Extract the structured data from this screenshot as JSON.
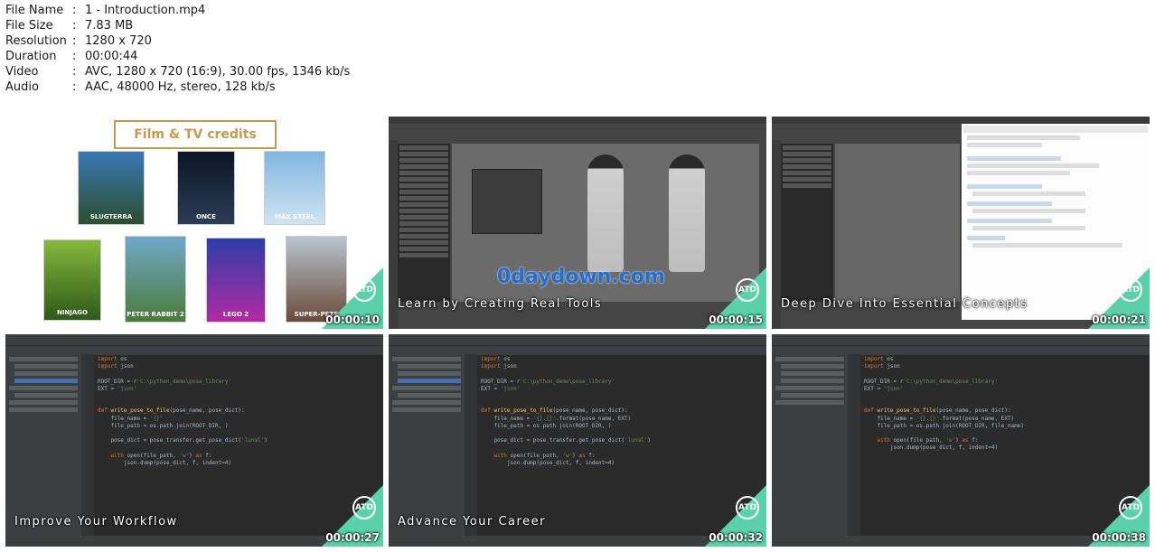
{
  "file_info": [
    {
      "label": "File Name",
      "value": "1 - Introduction.mp4"
    },
    {
      "label": "File Size",
      "value": "7.83 MB"
    },
    {
      "label": "Resolution",
      "value": "1280 x 720"
    },
    {
      "label": "Duration",
      "value": "00:00:44"
    },
    {
      "label": "Video",
      "value": "AVC, 1280 x 720 (16:9), 30.00 fps, 1346 kb/s"
    },
    {
      "label": "Audio",
      "value": "AAC, 48000 Hz, stereo, 128 kb/s"
    }
  ],
  "separator": ":",
  "badge": "ATD",
  "accent": "#5ad1a8",
  "thumbs": [
    {
      "caption": "",
      "timestamp": "00:00:10",
      "film_title": "Film & TV credits",
      "posters": [
        "SLUGTERRA",
        "ONCE",
        "MAX STEEL",
        "NINJAGO",
        "PETER RABBIT 2",
        "LEGO 2",
        "SUPER-PETS"
      ]
    },
    {
      "caption": "Learn by Creating Real Tools",
      "timestamp": "00:00:15",
      "watermark": "0daydown.com"
    },
    {
      "caption": "Deep Dive Into Essential Concepts",
      "timestamp": "00:00:21"
    },
    {
      "caption": "Improve Your Workflow",
      "timestamp": "00:00:27"
    },
    {
      "caption": "Advance Your Career",
      "timestamp": "00:00:32"
    },
    {
      "caption": "",
      "timestamp": "00:00:38"
    }
  ]
}
